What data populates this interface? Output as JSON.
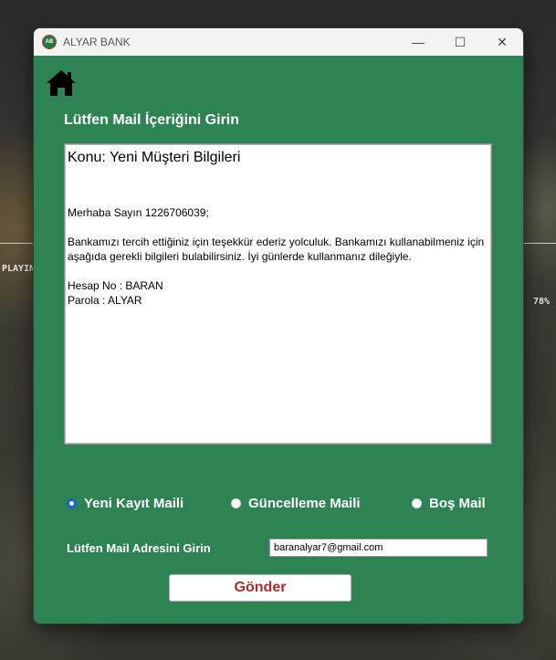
{
  "desktop": {
    "left_text": "PLAYIN",
    "right_text": "78%"
  },
  "window": {
    "title": "ALYAR BANK",
    "icon_text": "AB",
    "controls": {
      "minimize": "—",
      "maximize": "☐",
      "close": "✕"
    }
  },
  "form": {
    "heading": "Lütfen Mail İçeriğini Girin",
    "mail": {
      "subject": "Konu: Yeni Müşteri Bilgileri",
      "greeting": "Merhaba Sayın 1226706039;",
      "paragraph": "Bankamızı tercih ettiğiniz için teşekkür ederiz yolculuk. Bankamızı kullanabilmeniz için aşağıda gerekli bilgileri bulabilirsiniz. İyi günlerde kullanmanız dileğiyle.",
      "account_line": "Hesap No : BARAN",
      "password_line": "Parola : ALYAR"
    },
    "radios": [
      {
        "label": "Yeni Kayıt Maili",
        "selected": true
      },
      {
        "label": "Güncelleme Maili",
        "selected": false
      },
      {
        "label": "Boş Mail",
        "selected": false
      }
    ],
    "address_label": "Lütfen Mail Adresini Girin",
    "address_value": "baranalyar7@gmail.com",
    "send_label": "Gönder"
  },
  "colors": {
    "window_bg": "#2e8353",
    "send_text": "#b02a2a",
    "radio_selected": "#1565d8"
  }
}
